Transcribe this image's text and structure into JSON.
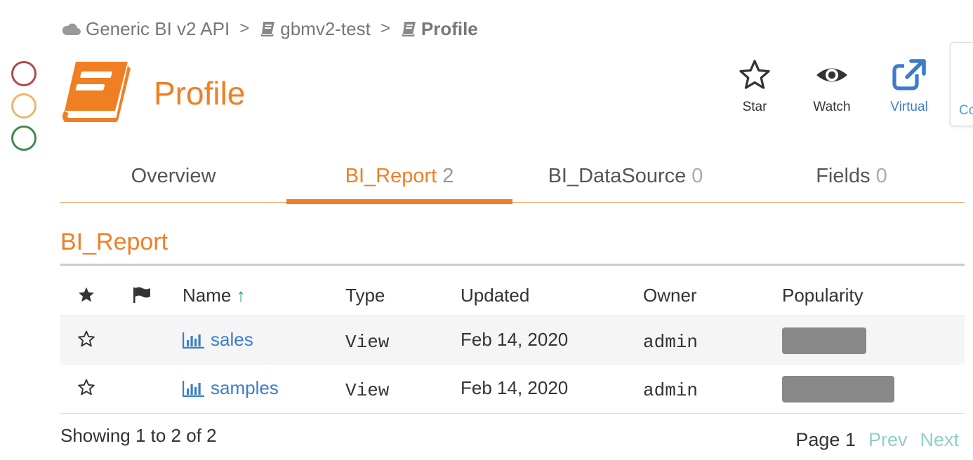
{
  "breadcrumb": {
    "items": [
      {
        "label": "Generic BI v2 API",
        "icon": "cloud-icon"
      },
      {
        "label": "gbmv2-test",
        "icon": "book-icon"
      },
      {
        "label": "Profile",
        "icon": "book-icon"
      }
    ],
    "separator": ">"
  },
  "header": {
    "title": "Profile",
    "icon": "book-icon",
    "accent_color": "#f07f24",
    "actions": [
      {
        "label": "Star",
        "icon": "star-outline-icon"
      },
      {
        "label": "Watch",
        "icon": "eye-icon"
      },
      {
        "label": "Virtual",
        "icon": "external-link-icon"
      }
    ],
    "edge_panel_label": "Co"
  },
  "window_controls": {
    "colors": [
      "#b34a4a",
      "#e8b86a",
      "#3f8a4a"
    ]
  },
  "tabs": [
    {
      "label": "Overview",
      "count": ""
    },
    {
      "label": "BI_Report",
      "count": "2",
      "active": true
    },
    {
      "label": "BI_DataSource",
      "count": "0"
    },
    {
      "label": "Fields",
      "count": "0"
    }
  ],
  "section": {
    "title": "BI_Report"
  },
  "table": {
    "columns": [
      "",
      "",
      "Name",
      "Type",
      "Updated",
      "Owner",
      "Popularity"
    ],
    "header_icons": [
      "star-filled-icon",
      "flag-icon"
    ],
    "sort_indicator": "↑",
    "rows": [
      {
        "name": "sales",
        "type": "View",
        "updated": "Feb 14, 2020",
        "owner": "admin",
        "popularity": 0.75
      },
      {
        "name": "samples",
        "type": "View",
        "updated": "Feb 14, 2020",
        "owner": "admin",
        "popularity": 1.0
      }
    ]
  },
  "footer": {
    "showing": "Showing 1 to 2 of 2",
    "page": "Page 1",
    "prev": "Prev",
    "next": "Next"
  }
}
